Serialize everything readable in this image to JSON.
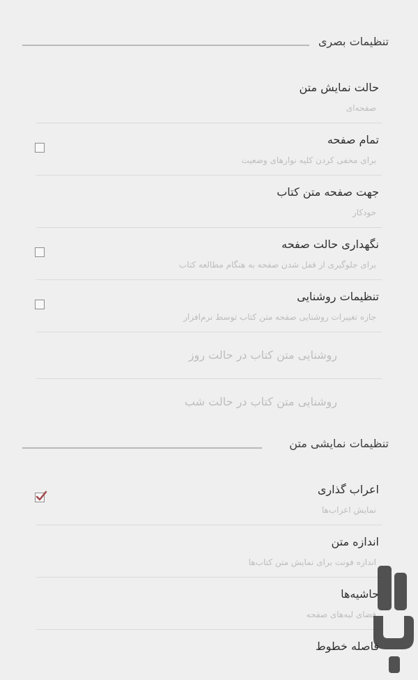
{
  "sections": {
    "visual": {
      "title": "تنظیمات بصری"
    },
    "text": {
      "title": "تنظیمات نمایشی متن"
    }
  },
  "rows": [
    {
      "label": "حالت نمایش متن",
      "summary": "صفحه‌ای",
      "has_checkbox": false,
      "checked": false
    },
    {
      "label": "تمام صفحه",
      "summary": "برای مخفی کردن کلیه نوارهای وضعیت",
      "has_checkbox": true,
      "checked": false
    },
    {
      "label": "جهت صفحه متن کتاب",
      "summary": "خودکار",
      "has_checkbox": false,
      "checked": false
    },
    {
      "label": "نگهداری حالت صفحه",
      "summary": "برای جلوگیری از قفل شدن صفحه به هنگام مطالعه کتاب",
      "has_checkbox": true,
      "checked": false
    },
    {
      "label": "تنظیمات روشنایی",
      "summary": "جازه تغییرات روشنایی صفحه متن کتاب توسط نرم‌افزار",
      "has_checkbox": true,
      "checked": false
    },
    {
      "label": "روشنایی متن کتاب در حالت روز",
      "summary": "",
      "disabled": true
    },
    {
      "label": "روشنایی متن کتاب در حالت شب",
      "summary": "",
      "disabled": true
    },
    {
      "label": "اعراب گذاری",
      "summary": "نمایش اعراب‌ها",
      "has_checkbox": true,
      "checked": true
    },
    {
      "label": "اندازه متن",
      "summary": "اندازه فونت برای نمایش متن کتاب‌ها",
      "has_checkbox": false,
      "checked": false
    },
    {
      "label": "حاشیه‌ها",
      "summary": "فضای لبه‌های صفحه",
      "has_checkbox": false,
      "checked": false
    },
    {
      "label": "فاصله خطوط",
      "summary": "",
      "has_checkbox": false,
      "checked": false
    }
  ],
  "colors": {
    "background": "#efefef",
    "checkmark": "#a2484b",
    "watermark": "#2f2f2f"
  },
  "icons": {
    "checkbox_checked": "check-icon",
    "watermark": "app-logo"
  }
}
